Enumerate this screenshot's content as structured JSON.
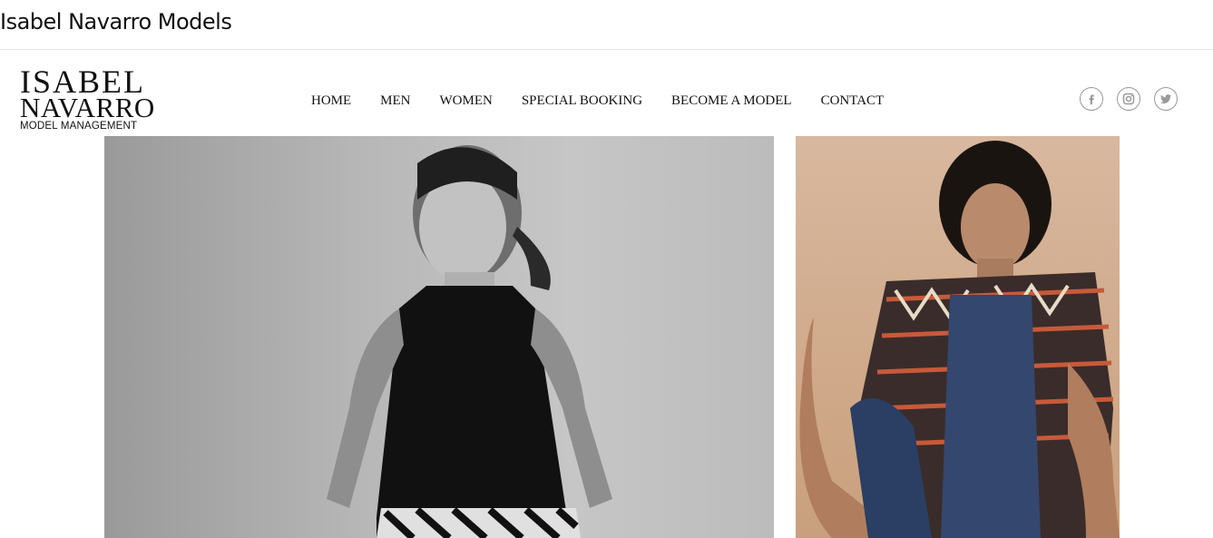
{
  "tab": {
    "title": "Isabel Navarro Models"
  },
  "logo": {
    "line1": "ISABEL",
    "line2": "NAVARRO",
    "line3": "MODEL MANAGEMENT"
  },
  "nav": {
    "items": [
      "HOME",
      "MEN",
      "WOMEN",
      "SPECIAL BOOKING",
      "BECOME A MODEL",
      "CONTACT"
    ]
  },
  "social": {
    "icons": [
      "facebook-icon",
      "instagram-icon",
      "twitter-icon"
    ]
  },
  "gallery": {
    "photos": [
      {
        "name": "woman-black-white-portrait"
      },
      {
        "name": "man-patterned-shirt-portrait"
      }
    ]
  }
}
